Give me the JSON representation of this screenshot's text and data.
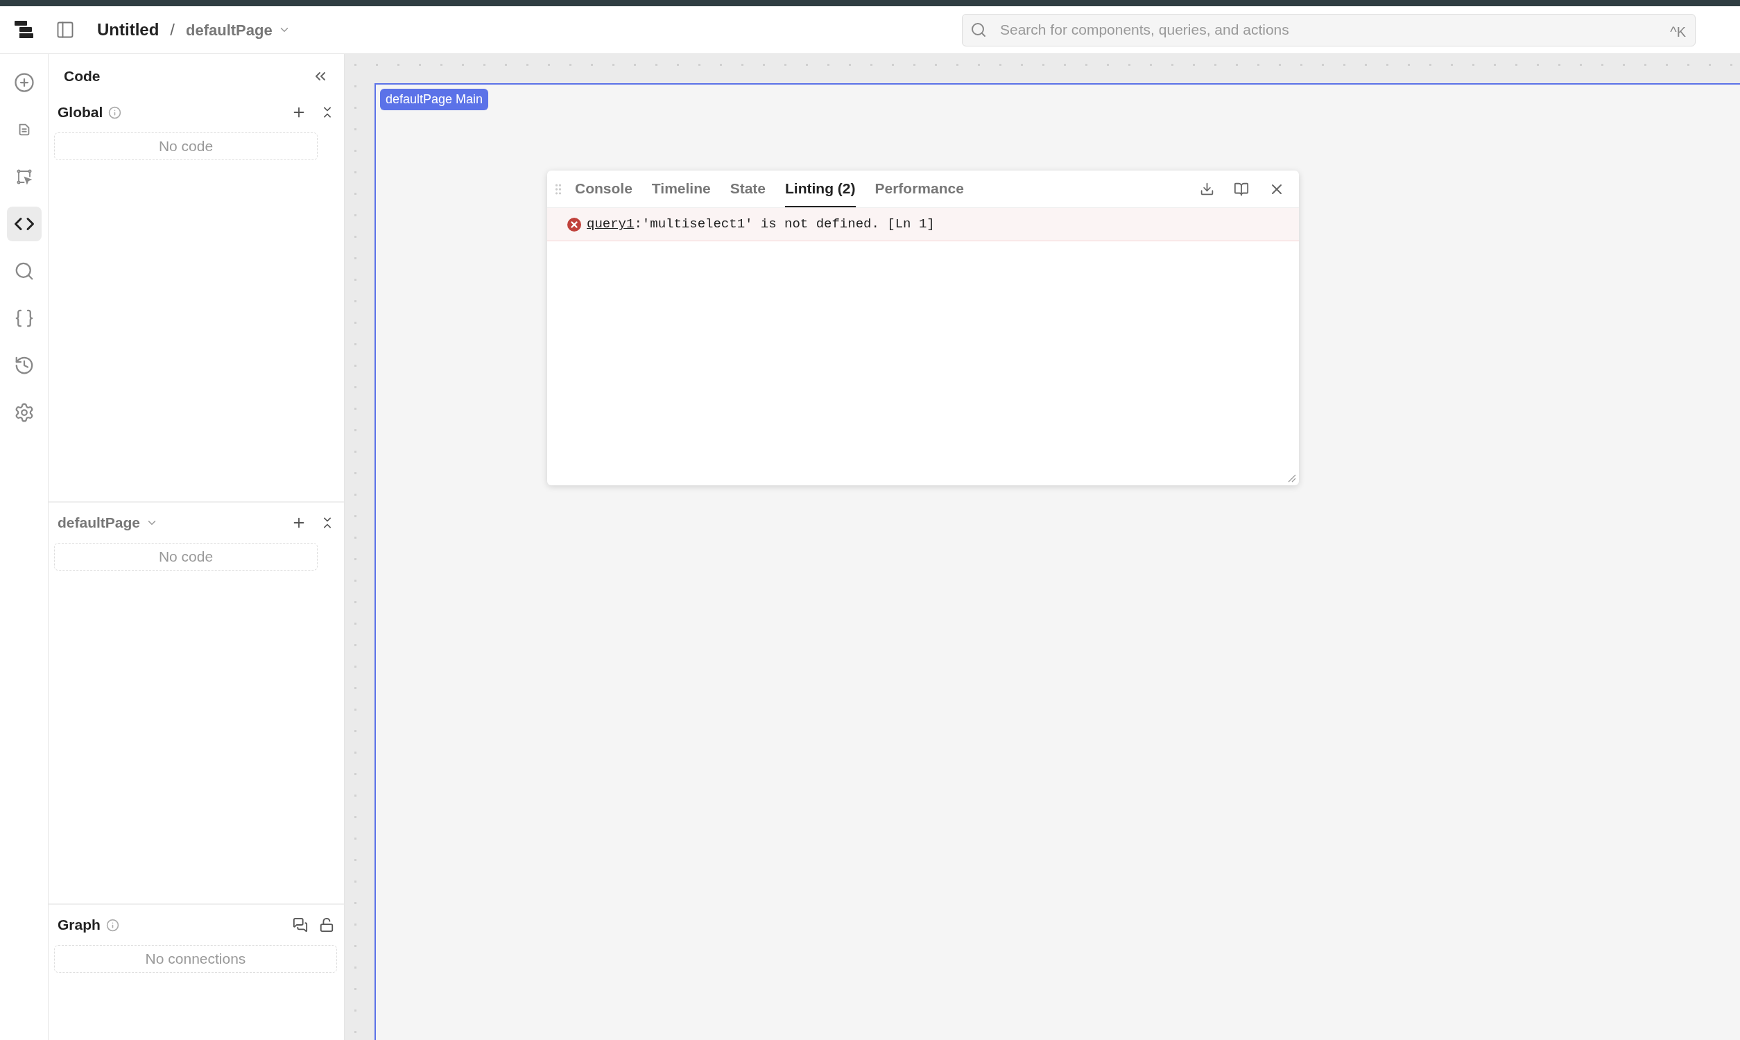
{
  "topbar": {
    "app_title": "Untitled",
    "separator": "/",
    "page": "defaultPage",
    "search": {
      "placeholder": "Search for components, queries, and actions",
      "shortcut": "^K"
    }
  },
  "rail": [
    {
      "kind": "add",
      "selected": false
    },
    {
      "kind": "document",
      "selected": false
    },
    {
      "kind": "select",
      "selected": false
    },
    {
      "kind": "code",
      "selected": true
    },
    {
      "kind": "search",
      "selected": false
    },
    {
      "kind": "state",
      "selected": false
    },
    {
      "kind": "history",
      "selected": false
    },
    {
      "kind": "settings",
      "selected": false
    }
  ],
  "code_panel": {
    "title": "Code",
    "sections": [
      {
        "kind": "global",
        "title": "Global",
        "empty_text": "No code"
      },
      {
        "kind": "page",
        "title": "defaultPage",
        "empty_text": "No code"
      }
    ],
    "graph": {
      "title": "Graph",
      "empty_text": "No connections"
    }
  },
  "canvas": {
    "frame_label": "defaultPage Main"
  },
  "debug_panel": {
    "tabs": [
      {
        "label": "Console",
        "selected": false
      },
      {
        "label": "Timeline",
        "selected": false
      },
      {
        "label": "State",
        "selected": false
      },
      {
        "label": "Linting (2)",
        "selected": true
      },
      {
        "label": "Performance",
        "selected": false
      }
    ],
    "messages": [
      {
        "kind": "error",
        "source": "query1",
        "separator": ":",
        "text": "'multiselect1' is not defined. [Ln 1]"
      }
    ]
  }
}
